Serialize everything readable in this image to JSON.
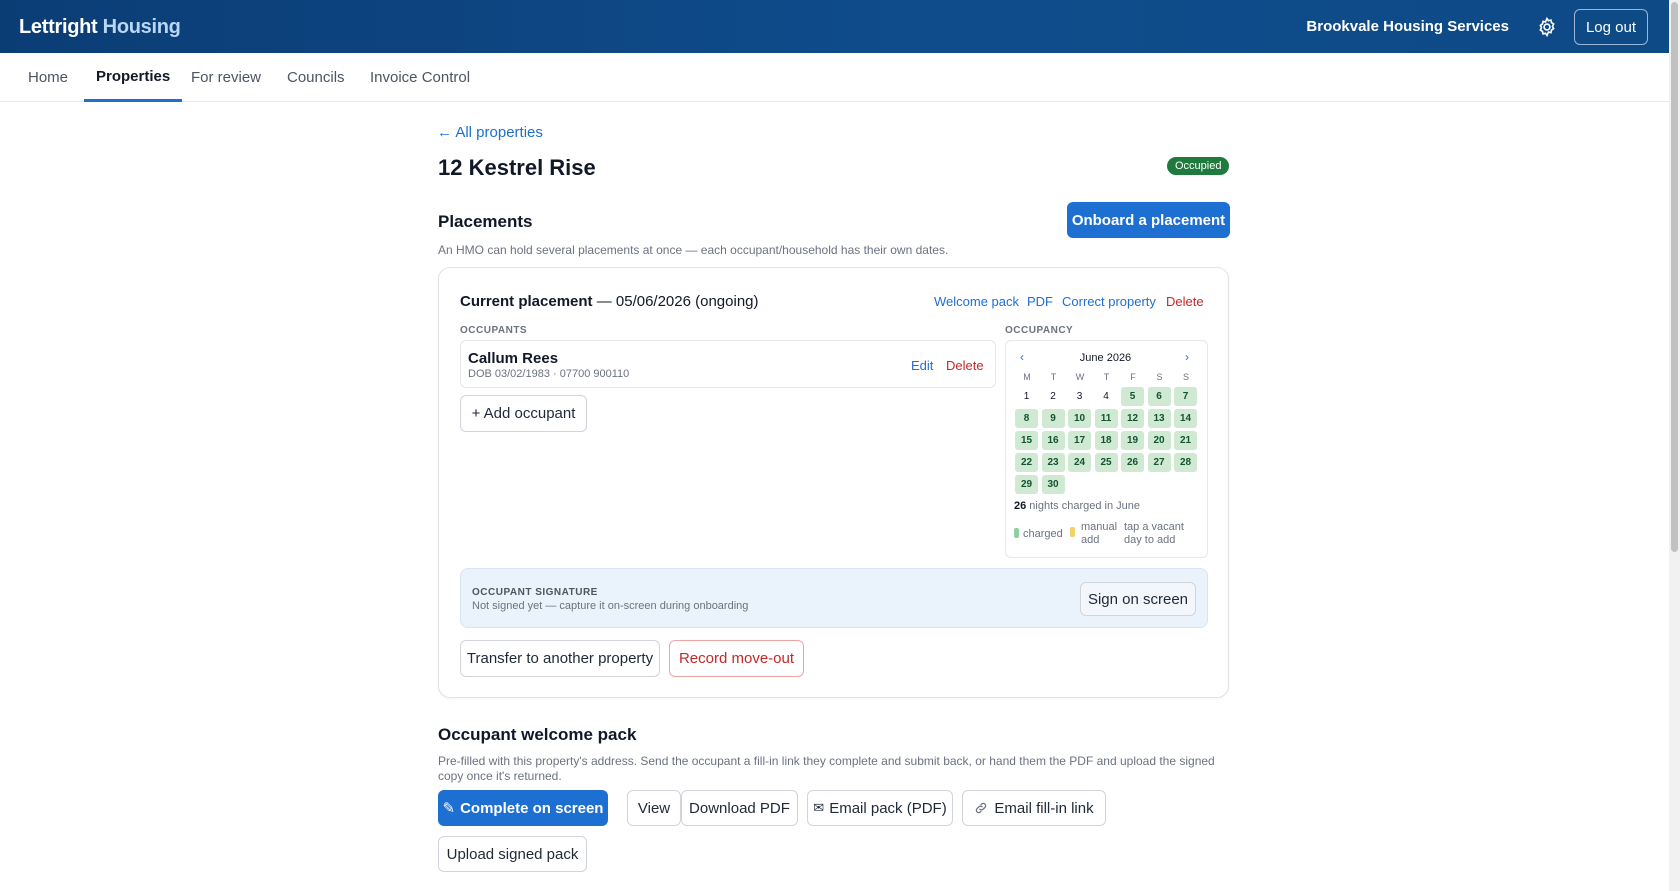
{
  "header": {
    "brand_part1": "Lettright",
    "brand_part2": "Housing",
    "org_name": "Brookvale Housing Services",
    "settings_icon": "gear-icon",
    "logout_label": "Log out"
  },
  "nav": {
    "items": [
      {
        "label": "Home",
        "active": false
      },
      {
        "label": "Properties",
        "active": true
      },
      {
        "label": "For review",
        "active": false
      },
      {
        "label": "Councils",
        "active": false
      },
      {
        "label": "Invoice Control",
        "active": false
      }
    ]
  },
  "property": {
    "back_link": "← All properties",
    "title": "12 Kestrel Rise",
    "status": "Occupied",
    "status_color": "#1f7a3d"
  },
  "placements": {
    "heading": "Placements",
    "onboard_button": "Onboard a placement",
    "description": "An HMO can hold several placements at once — each occupant/household has their own dates.",
    "current": {
      "label": "Current placement",
      "dates": " — 05/06/2026 (ongoing)",
      "actions": {
        "welcome_pack": "Welcome pack",
        "pdf": "PDF",
        "correct_property": "Correct property",
        "delete": "Delete"
      },
      "occupants_label": "OCCUPANTS",
      "occupants": [
        {
          "name": "Callum Rees",
          "details": "DOB 03/02/1983 · 07700 900110",
          "edit": "Edit",
          "delete": "Delete"
        }
      ],
      "add_occupant": "+ Add occupant",
      "occupancy_label": "OCCUPANCY",
      "calendar": {
        "month": "June 2026",
        "prev": "‹",
        "next": "›",
        "weekdays": [
          "M",
          "T",
          "W",
          "T",
          "F",
          "S",
          "S"
        ],
        "first_weekday_index": 0,
        "days_in_month": 30,
        "charged_from_day": 5,
        "nights_count": "26",
        "nights_text": " nights charged in June"
      },
      "legend": {
        "charged": "charged",
        "manual": "manual add",
        "hint": "tap a vacant day to add",
        "charged_color": "#8fd19e",
        "manual_color": "#f2d16b"
      },
      "signature": {
        "label": "OCCUPANT SIGNATURE",
        "text": "Not signed yet — capture it on-screen during onboarding",
        "button": "Sign on screen"
      },
      "transfer_button": "Transfer to another property",
      "moveout_button": "Record move-out"
    }
  },
  "welcome_pack": {
    "heading": "Occupant welcome pack",
    "description": "Pre-filled with this property's address. Send the occupant a fill-in link they complete and submit back, or hand them the PDF and upload the signed copy once it's returned.",
    "buttons": {
      "complete": "Complete on screen",
      "view": "View",
      "download": "Download PDF",
      "email_pack": "Email pack (PDF)",
      "email_link": "Email fill-in link",
      "upload": "Upload signed pack"
    }
  }
}
